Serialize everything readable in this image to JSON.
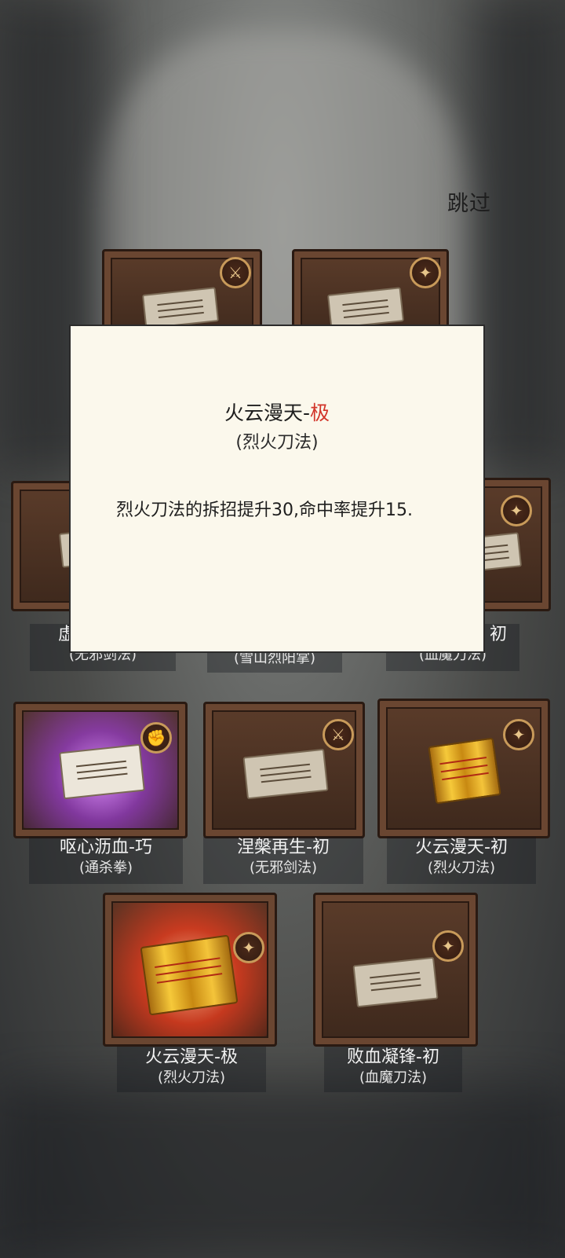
{
  "header": {
    "skip_label": "跳过"
  },
  "modal": {
    "title_name": "火云漫天-",
    "title_grade": "极",
    "school": "(烈火刀法)",
    "description": "烈火刀法的拆招提升30,命中率提升15.",
    "grade_color": "#d2352a"
  },
  "row1": [
    {
      "icon": "sword-icon",
      "visual": "paper-scroll"
    },
    {
      "icon": "blade-icon",
      "visual": "paper-scroll"
    }
  ],
  "row2": [
    {
      "name": "虚空",
      "school": "(无邪剑法)",
      "visual": "paper-scroll"
    },
    {
      "name": "",
      "school": "(雪山烈阳掌)",
      "visual": "paper-scroll"
    },
    {
      "name": "初",
      "school": "(血魔刀法)",
      "icon": "blade-icon",
      "visual": "paper-scroll"
    }
  ],
  "row3": [
    {
      "name": "呕心沥血-巧",
      "school": "(通杀拳)",
      "icon": "fist-icon",
      "visual": "paper-scroll",
      "glow": "#b04ad8"
    },
    {
      "name": "涅槃再生-初",
      "school": "(无邪剑法)",
      "icon": "sword-icon",
      "visual": "paper-scroll"
    },
    {
      "name": "火云漫天-初",
      "school": "(烈火刀法)",
      "icon": "blade-icon",
      "visual": "gold-scroll"
    }
  ],
  "row4": [
    {
      "name": "火云漫天-极",
      "school": "(烈火刀法)",
      "icon": "blade-icon",
      "visual": "gold-scroll",
      "glow": "#e0321e"
    },
    {
      "name": "败血凝锋-初",
      "school": "(血魔刀法)",
      "icon": "blade-icon",
      "visual": "paper-scroll"
    }
  ]
}
